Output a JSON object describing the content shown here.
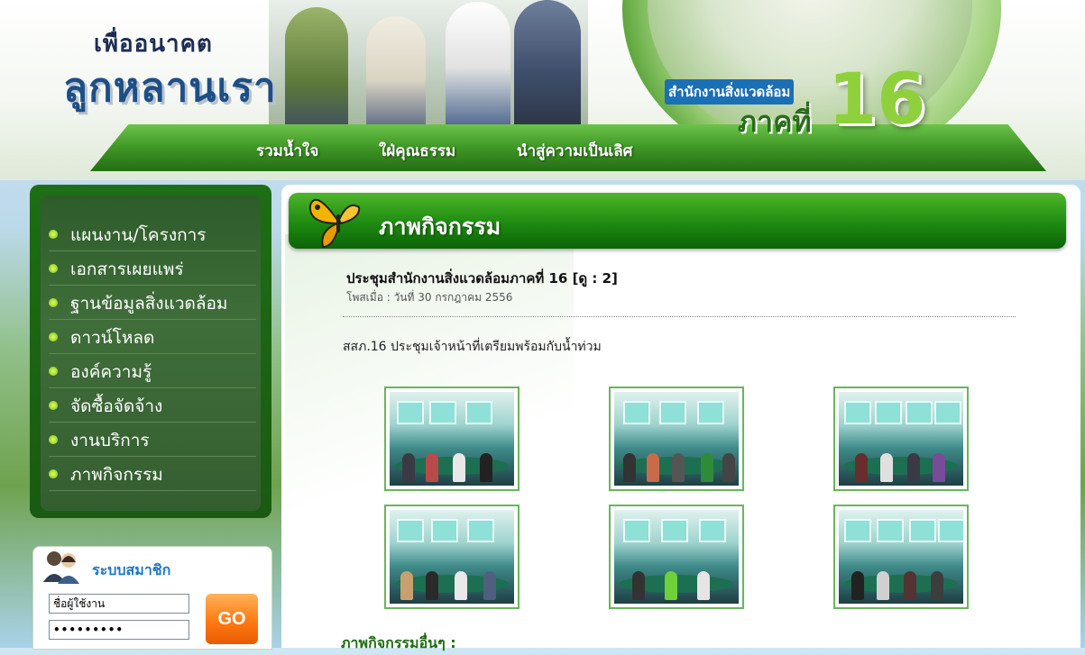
{
  "header": {
    "logo_small": "เพื่ออนาคต",
    "logo_big": "ลูกหลานเรา",
    "office_line1": "สำนักงานสิ่งแวดล้อม",
    "office_line2": "ภาคที่",
    "office_number": "16",
    "nav": [
      {
        "label": "รวมน้ำใจ"
      },
      {
        "label": "ใฝ่คุณธรรม"
      },
      {
        "label": "นำสู่ความเป็นเลิศ"
      }
    ]
  },
  "sidebar": {
    "menu": [
      {
        "label": "แผนงาน/โครงการ"
      },
      {
        "label": "เอกสารเผยแพร่"
      },
      {
        "label": "ฐานข้อมูลสิ่งแวดล้อม"
      },
      {
        "label": "ดาวน์โหลด"
      },
      {
        "label": "องค์ความรู้"
      },
      {
        "label": "จัดซื้อจัดจ้าง"
      },
      {
        "label": "งานบริการ"
      },
      {
        "label": "ภาพกิจกรรม"
      }
    ],
    "login": {
      "title": "ระบบสมาชิก",
      "username_value": "ชื่อผู้ใช้งาน",
      "password_value": "•••••••••",
      "go_label": "GO"
    }
  },
  "main": {
    "page_title": "ภาพกิจกรรม",
    "post_title": "ประชุมสำนักงานสิ่งแวดล้อมภาคที่ 16 [ดู : 2]",
    "post_date": "โพสเมื่อ : วันที่ 30 กรกฎาคม 2556",
    "post_body": "สสภ.16 ประชุมเจ้าหน้าที่เตรียมพร้อมกับน้ำท่วม",
    "other_heading": "ภาพกิจกรรมอื่นๆ :"
  },
  "colors": {
    "brand_green": "#1e8a10",
    "nav_green": "#3e9625",
    "go_orange": "#ff7a12",
    "login_blue": "#1a78c8"
  }
}
